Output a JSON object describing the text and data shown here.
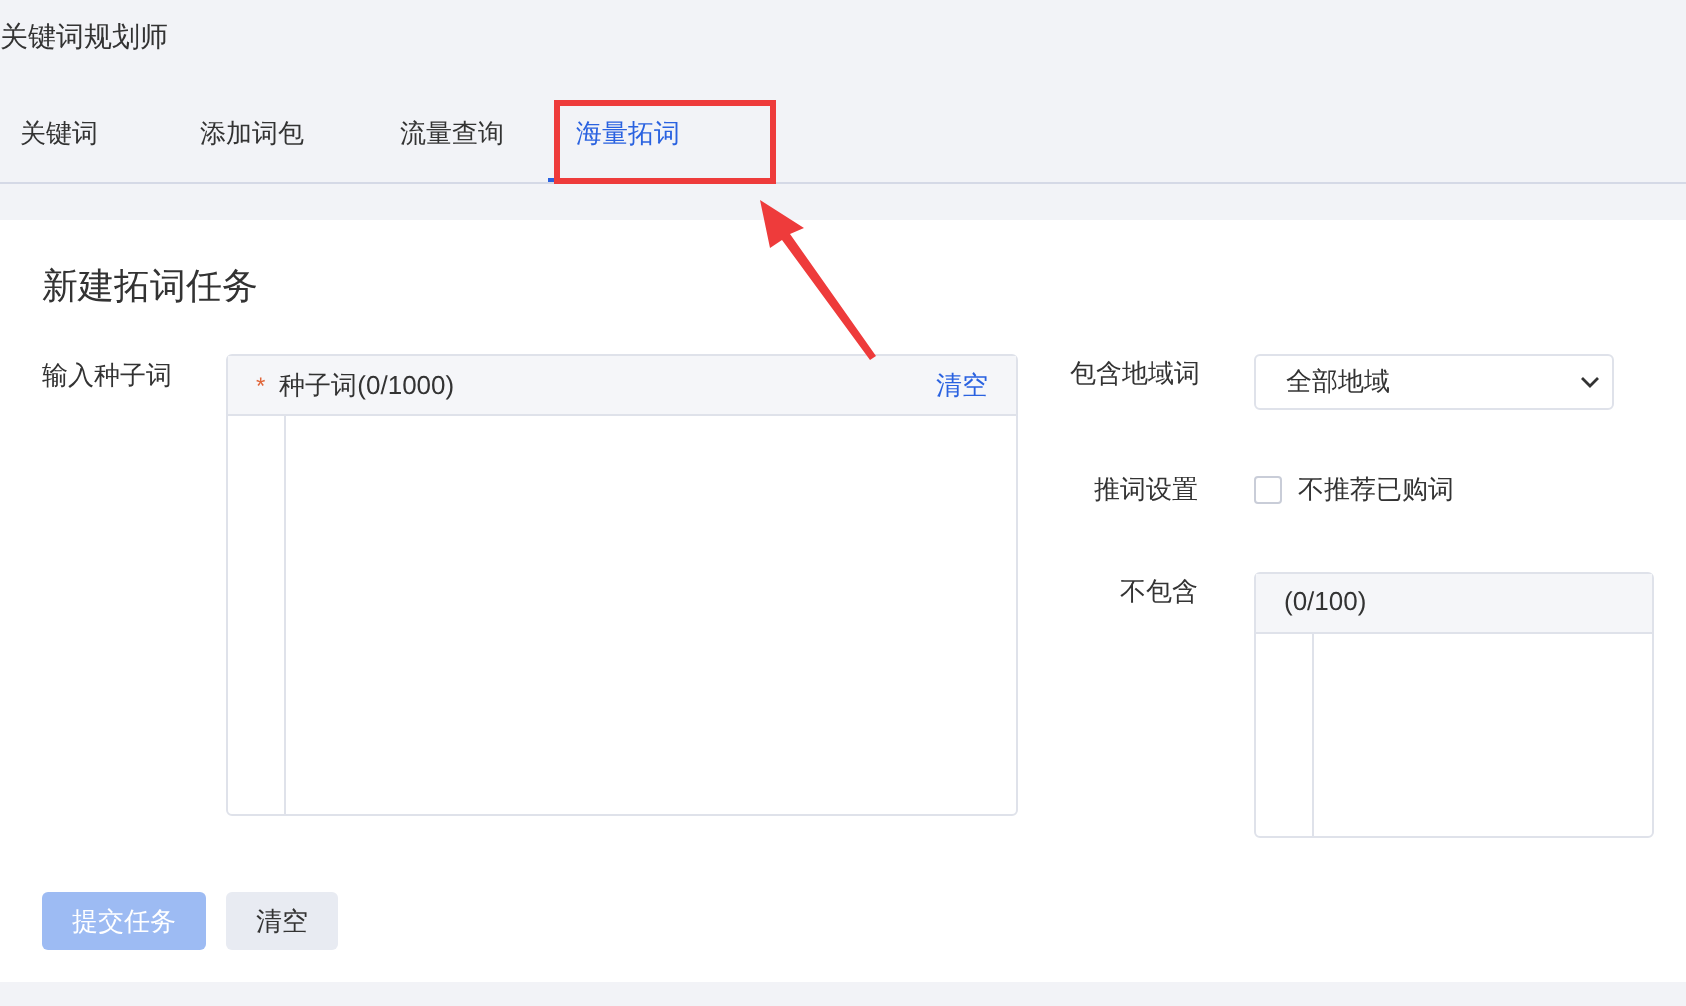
{
  "app_title": "关键词规划师",
  "tabs": [
    {
      "label": "关键词",
      "selected": false
    },
    {
      "label": "添加词包",
      "selected": false
    },
    {
      "label": "流量查询",
      "selected": false
    },
    {
      "label": "海量拓词",
      "selected": true
    }
  ],
  "form": {
    "title": "新建拓词任务",
    "seed": {
      "label": "输入种子词",
      "required_mark": "*",
      "header": "种子词(0/1000)",
      "clear": "清空"
    },
    "region": {
      "label": "包含地域词",
      "value": "全部地域"
    },
    "recommend": {
      "label": "推词设置",
      "option": "不推荐已购词",
      "checked": false
    },
    "exclude": {
      "label": "不包含",
      "header": "(0/100)"
    },
    "buttons": [
      {
        "label": "提交任务",
        "kind": "primary",
        "disabled": true
      },
      {
        "label": "清空",
        "kind": "secondary",
        "disabled": false
      }
    ]
  }
}
